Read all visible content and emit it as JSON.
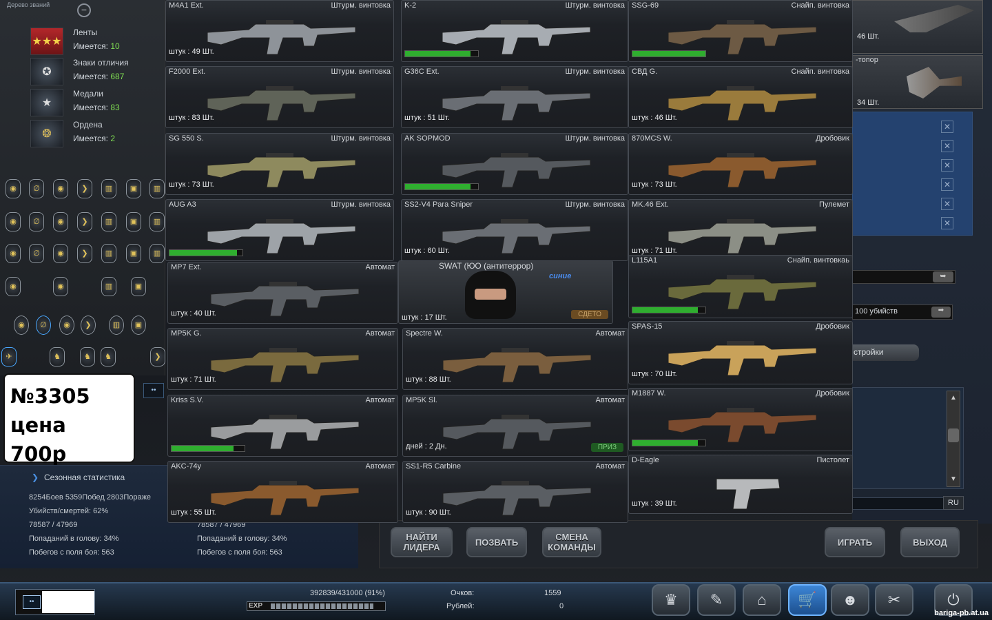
{
  "left_panel": {
    "title": "Дерево званий",
    "awards": [
      {
        "name": "Ленты",
        "count_label": "Имеется:",
        "count": "10",
        "icon": "ribbon-icon"
      },
      {
        "name": "Знаки отличия",
        "count_label": "Имеется:",
        "count": "687",
        "icon": "insignia-icon"
      },
      {
        "name": "Медали",
        "count_label": "Имеется:",
        "count": "83",
        "icon": "medal-icon"
      },
      {
        "name": "Ордена",
        "count_label": "Имеется:",
        "count": "2",
        "icon": "order-icon"
      }
    ]
  },
  "price_box": {
    "line1": "№3305",
    "line2": "цена 700р"
  },
  "season": {
    "title": "Сезонная статистика",
    "battles": "8254Боев 5359Побед 2803Пораже",
    "kd": "Убийств/смертей: 62%",
    "exp_left": "78587 / 47969",
    "exp_right": "78587 / 47969",
    "headshots_left": "Попаданий в голову: 34%",
    "headshots_right": "Попаданий в голову: 34%",
    "escapes_left": "Побегов с поля боя: 563",
    "escapes_right": "Побегов с поля боя: 563"
  },
  "right_panel": {
    "count_top": "46 Шт.",
    "axe_label": "-топор",
    "count_axe": "34 Шт.",
    "bonus": "100 убийств",
    "settings": "стройки",
    "lang": "RU"
  },
  "weapons": [
    {
      "name": "M4A1 Ext.",
      "cat": "Штурм. винтовка",
      "qty": "штук : 49 Шт."
    },
    {
      "name": "K-2",
      "cat": "Штурм. винтовка",
      "bar": 0.9
    },
    {
      "name": "SSG-69",
      "cat": "Снайп. винтовка",
      "bar": 1.0
    },
    {
      "name": "F2000 Ext.",
      "cat": "Штурм. винтовка",
      "qty": "штук : 83 Шт."
    },
    {
      "name": "G36C Ext.",
      "cat": "Штурм. винтовка",
      "qty": "штук : 51 Шт."
    },
    {
      "name": "СВД G.",
      "cat": "Снайп. винтовка",
      "qty": "штук : 46 Шт."
    },
    {
      "name": "SG 550 S.",
      "cat": "Штурм. винтовка",
      "qty": "штук : 73 Шт."
    },
    {
      "name": "AK SOPMOD",
      "cat": "Штурм. винтовка",
      "bar": 0.9
    },
    {
      "name": "870MCS W.",
      "cat": "Дробовик",
      "qty": "штук : 73 Шт."
    },
    {
      "name": "AUG A3",
      "cat": "Штурм. винтовка",
      "bar": 0.92
    },
    {
      "name": "SS2-V4 Para Sniper",
      "cat": "Штурм. винтовка",
      "qty": "штук : 60 Шт."
    },
    {
      "name": "MK.46 Ext.",
      "cat": "Пулемет",
      "qty": "штук : 71 Шт."
    },
    {
      "name": "MP7 Ext.",
      "cat": "Автомат",
      "qty": "штук : 40 Шт."
    },
    {
      "name": "SWAT (ЮО (антитеррор)",
      "cat": "",
      "qty": "штук : 17 Шт.",
      "team": "синие",
      "badge": "СДЕТО"
    },
    {
      "name": "L115A1",
      "cat": "Снайп. винтовкаь",
      "bar": 0.9
    },
    {
      "name": "MP5K G.",
      "cat": "Автомат",
      "qty": "штук : 71 Шт."
    },
    {
      "name": "Spectre W.",
      "cat": "Автомат",
      "qty": "штук : 88 Шт."
    },
    {
      "name": "SPAS-15",
      "cat": "Дробовик",
      "qty": "штук : 70 Шт."
    },
    {
      "name": "Kriss S.V.",
      "cat": "Автомат",
      "bar": 0.85
    },
    {
      "name": "MP5K Sl.",
      "cat": "Автомат",
      "qty": "дней : 2 Дн.",
      "badge": "ПРИЗ"
    },
    {
      "name": "M1887 W.",
      "cat": "Дробовик",
      "bar": 0.9
    },
    {
      "name": "AKC-74у",
      "cat": "Автомат",
      "qty": "штук : 55 Шт."
    },
    {
      "name": "SS1-R5 Carbine",
      "cat": "Автомат",
      "qty": "штук : 90 Шт."
    },
    {
      "name": "D-Eagle",
      "cat": "Пистолет",
      "qty": "штук : 39 Шт."
    }
  ],
  "buttons": {
    "find_leader": "НАЙТИ ЛИДЕРА",
    "invite": "ПОЗВАТЬ",
    "change_team": "СМЕНА КОМАНДЫ",
    "play": "ИГРАТЬ",
    "exit": "ВЫХОД"
  },
  "status": {
    "exp": "392839/431000 (91%)",
    "exp_fill": 0.91,
    "exp_label": "EXP",
    "points_label": "Очков:",
    "points": "1559",
    "rubles_label": "Рублей:",
    "rubles": "0",
    "site": "bariga-pb.at.ua"
  }
}
